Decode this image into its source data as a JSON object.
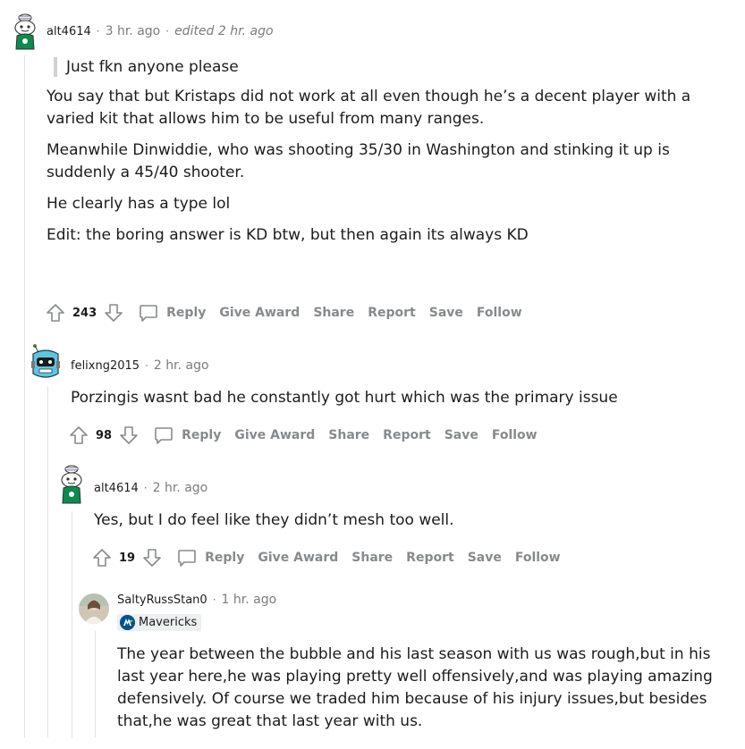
{
  "comments": [
    {
      "author": "alt4614",
      "time": "3 hr. ago",
      "edited": "edited 2 hr. ago",
      "quote": "Just fkn anyone please",
      "paragraphs": [
        "You say that but Kristaps did not work at all even though he’s a decent player with a varied kit that allows him to be useful from many ranges.",
        "Meanwhile Dinwiddie, who was shooting 35/30 in Washington and stinking it up is suddenly a 45/40 shooter.",
        "He clearly has a type lol",
        "Edit: the boring answer is KD btw, but then again its always KD"
      ],
      "score": "243",
      "avatar_icon": "snoo-avatar-icon"
    },
    {
      "author": "felixng2015",
      "time": "2 hr. ago",
      "paragraphs": [
        "Porzingis wasnt bad he constantly got hurt which was the primary issue"
      ],
      "score": "98",
      "avatar_icon": "robot-avatar-icon"
    },
    {
      "author": "alt4614",
      "time": "2 hr. ago",
      "paragraphs": [
        "Yes, but I do feel like they didn’t mesh too well."
      ],
      "score": "19",
      "avatar_icon": "snoo-avatar-icon"
    },
    {
      "author": "SaltyRussStan0",
      "time": "1 hr. ago",
      "flair": "Mavericks",
      "paragraphs": [
        "The year between the bubble and his last season with us was rough,but in his last year here,he was playing pretty well offensively,and was playing amazing defensively. Of course we traded him because of his injury issues,but besides that,he was great that last year with us."
      ],
      "avatar_icon": "photo-avatar-icon"
    }
  ],
  "actions": {
    "reply": "Reply",
    "give_award": "Give Award",
    "share": "Share",
    "report": "Report",
    "save": "Save",
    "follow": "Follow"
  },
  "colors": {
    "meta_gray": "#7c7c7c",
    "action_gray": "#878a8c",
    "thread_line": "#e2e2e2",
    "flair_bg": "#edeff1",
    "avatar_green": "#0d8a4e"
  }
}
